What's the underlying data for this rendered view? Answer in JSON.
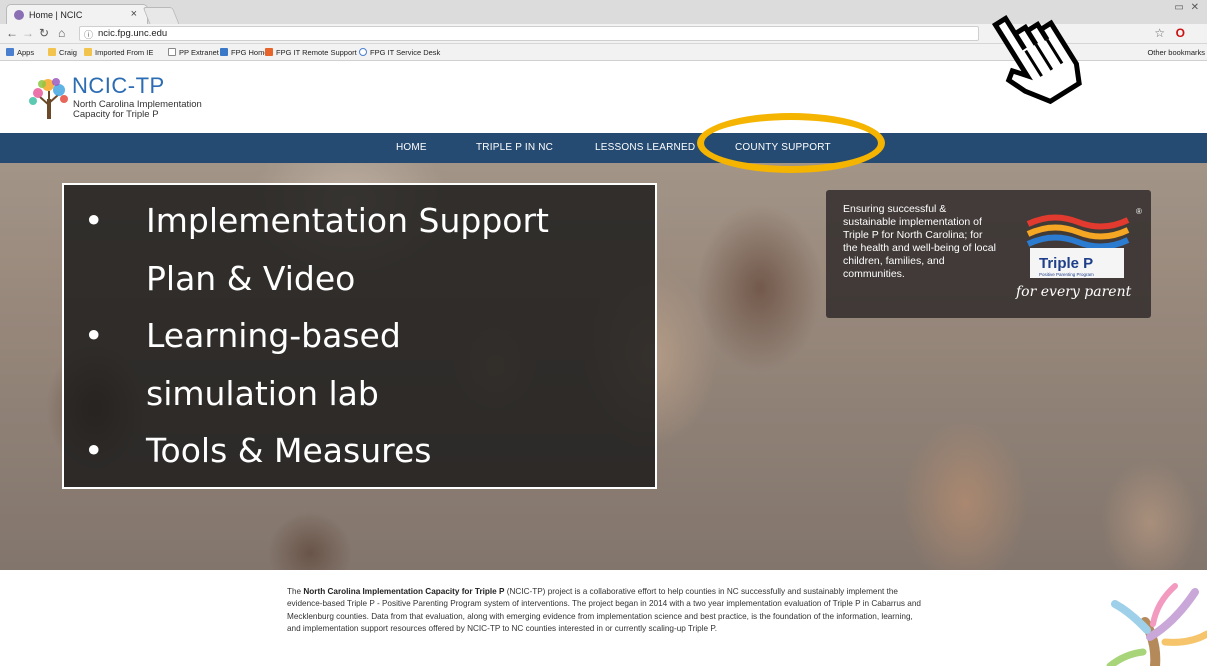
{
  "browser": {
    "tab_title": "Home | NCIC",
    "url": "ncic.fpg.unc.edu",
    "bookmarks": [
      "Apps",
      "Craig",
      "Imported From IE",
      "PP Extranet",
      "FPG Home",
      "FPG IT Remote Support",
      "FPG IT Service Desk"
    ],
    "other_bookmarks": "Other bookmarks"
  },
  "site": {
    "brand_main": "NCIC",
    "brand_suffix": "-TP",
    "tagline_line1": "North Carolina Implementation",
    "tagline_line2": "Capacity for Triple P"
  },
  "nav": {
    "items": [
      "HOME",
      "TRIPLE P IN NC",
      "LESSONS LEARNED",
      "COUNTY SUPPORT"
    ]
  },
  "callout": {
    "bullets": [
      {
        "lines": [
          "Implementation Support",
          "Plan & Video"
        ]
      },
      {
        "lines": [
          "Learning-based",
          "simulation lab"
        ]
      },
      {
        "lines": [
          "Tools & Measures"
        ]
      }
    ],
    "bullet_glyph": "•"
  },
  "mission": {
    "text": "Ensuring successful & sustainable implementation of Triple P for North Carolina; for the health and well-being of local children, families, and communities.",
    "logo_brand": "Triple P",
    "logo_sub": "Positive Parenting Program",
    "logo_slogan": "for every parent"
  },
  "intro": {
    "pre": "The ",
    "bold": "North Carolina Implementation Capacity for Triple P",
    "post": " (NCIC-TP) project is a collaborative effort to help counties in NC successfully and sustainably implement the evidence-based Triple P - Positive Parenting Program system of interventions. The project began in 2014 with a two year implementation evaluation of Triple P in Cabarrus and Mecklenburg counties. Data from that evaluation, along with  emerging evidence from implementation science and best practice, is the foundation of the information, learning, and implementation support resources offered by NCIC-TP to NC counties interested in or currently scaling-up Triple P."
  },
  "colors": {
    "nav_bg": "#264b72",
    "brand_blue": "#2b6cb3",
    "highlight_circle": "#f4b400"
  }
}
